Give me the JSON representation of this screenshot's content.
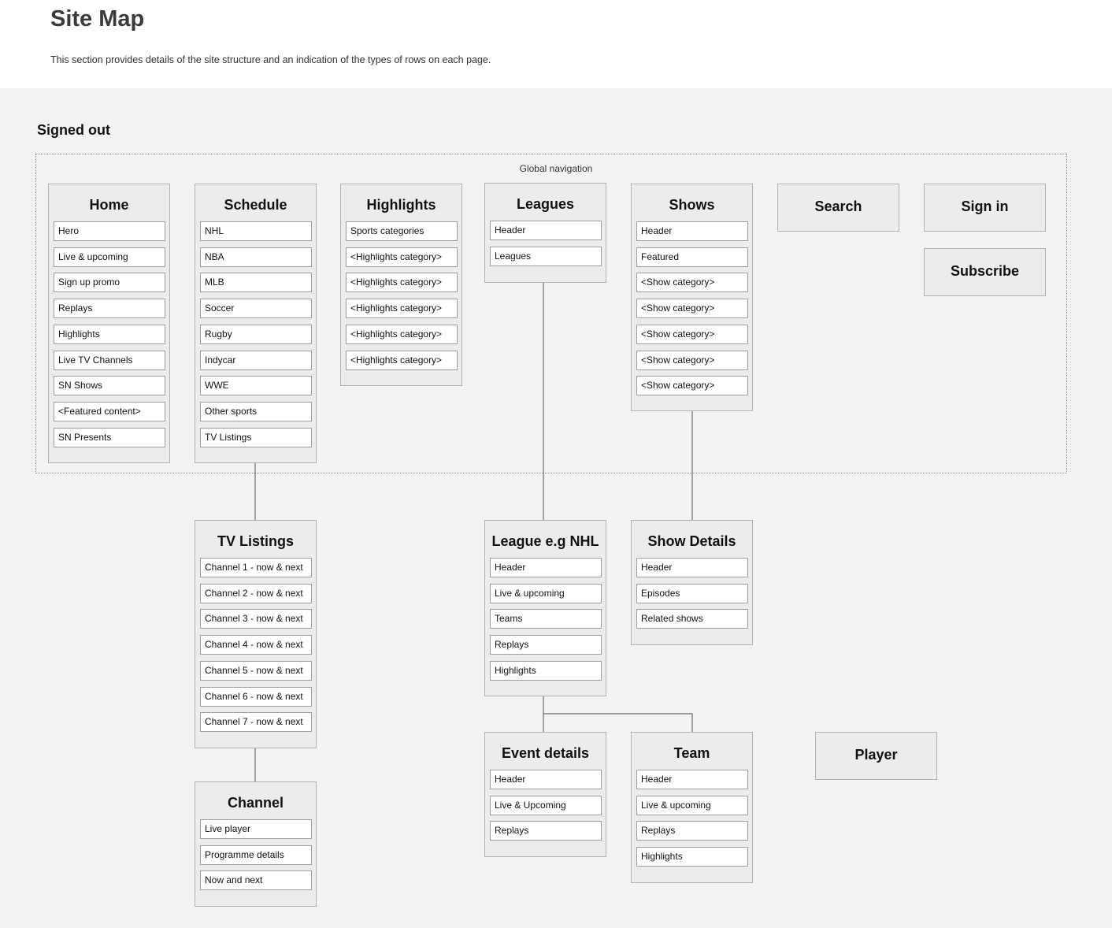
{
  "page": {
    "title": "Site Map",
    "description": "This section provides details of the site structure and an indication of the types of rows on each page."
  },
  "section": {
    "title": "Signed out",
    "group_label": "Global navigation"
  },
  "boxes": {
    "home": {
      "title": "Home",
      "items": [
        "Hero",
        "Live & upcoming",
        "Sign up promo",
        "Replays",
        "Highlights",
        "Live TV Channels",
        "SN Shows",
        "<Featured content>",
        "SN Presents"
      ]
    },
    "schedule": {
      "title": "Schedule",
      "items": [
        "NHL",
        "NBA",
        "MLB",
        "Soccer",
        "Rugby",
        "Indycar",
        "WWE",
        "Other sports",
        "TV Listings"
      ]
    },
    "highlights": {
      "title": "Highlights",
      "items": [
        "Sports categories",
        "<Highlights category>",
        "<Highlights category>",
        "<Highlights category>",
        "<Highlights category>",
        "<Highlights category>"
      ]
    },
    "leagues": {
      "title": "Leagues",
      "items": [
        "Header",
        "Leagues"
      ]
    },
    "shows": {
      "title": "Shows",
      "items": [
        "Header",
        "Featured",
        "<Show category>",
        "<Show category>",
        "<Show category>",
        "<Show category>",
        "<Show category>"
      ]
    },
    "search": {
      "title": "Search",
      "items": []
    },
    "signin": {
      "title": "Sign in",
      "items": []
    },
    "subscribe": {
      "title": "Subscribe",
      "items": []
    },
    "tvlistings": {
      "title": "TV Listings",
      "items": [
        "Channel 1 - now & next",
        "Channel 2 - now & next",
        "Channel 3 - now & next",
        "Channel 4 - now & next",
        "Channel 5 - now & next",
        "Channel 6 - now & next",
        "Channel 7 - now & next"
      ]
    },
    "league": {
      "title": "League e.g NHL",
      "items": [
        "Header",
        "Live & upcoming",
        "Teams",
        "Replays",
        "Highlights"
      ]
    },
    "showdetails": {
      "title": "Show Details",
      "items": [
        "Header",
        "Episodes",
        "Related shows"
      ]
    },
    "channel": {
      "title": "Channel",
      "items": [
        "Live player",
        "Programme details",
        "Now and next"
      ]
    },
    "eventdetails": {
      "title": "Event details",
      "items": [
        "Header",
        "Live & Upcoming",
        "Replays"
      ]
    },
    "team": {
      "title": "Team",
      "items": [
        "Header",
        "Live & upcoming",
        "Replays",
        "Highlights"
      ]
    },
    "player": {
      "title": "Player",
      "items": []
    }
  }
}
